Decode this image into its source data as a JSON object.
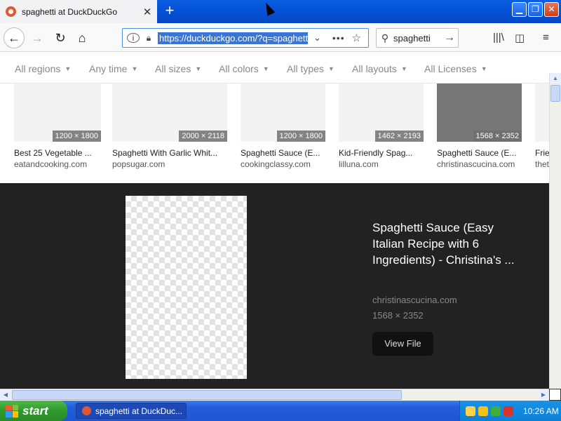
{
  "browser": {
    "tab_title": "spaghetti at DuckDuckGo",
    "url": "https://duckduckgo.com/?q=spaghetti",
    "search_query": "spaghetti"
  },
  "filters": [
    {
      "label": "All regions"
    },
    {
      "label": "Any time"
    },
    {
      "label": "All sizes"
    },
    {
      "label": "All colors"
    },
    {
      "label": "All types"
    },
    {
      "label": "All layouts"
    },
    {
      "label": "All Licenses"
    }
  ],
  "results": [
    {
      "title": "Best 25 Vegetable ...",
      "source": "eatandcooking.com",
      "dims": "1200 × 1800"
    },
    {
      "title": "Spaghetti With Garlic Whit...",
      "source": "popsugar.com",
      "dims": "2000 × 2118"
    },
    {
      "title": "Spaghetti Sauce (E...",
      "source": "cookingclassy.com",
      "dims": "1200 × 1800"
    },
    {
      "title": "Kid-Friendly Spag...",
      "source": "lilluna.com",
      "dims": "1462 × 2193"
    },
    {
      "title": "Spaghetti Sauce (E...",
      "source": "christinascucina.com",
      "dims": "1568 × 2352"
    },
    {
      "title": "Frie",
      "source": "thet",
      "dims": ""
    }
  ],
  "detail": {
    "title": "Spaghetti Sauce (Easy Italian Recipe with 6 Ingredients) - Christina's ...",
    "source": "christinascucina.com",
    "dims": "1568 × 2352",
    "view_file_label": "View File"
  },
  "taskbar": {
    "start_label": "start",
    "task_item": "spaghetti at DuckDuc...",
    "clock": "10:26 AM"
  },
  "colors": {
    "accent": "#3875d7",
    "detail_bg": "#222222",
    "favicon": "#de5833"
  }
}
